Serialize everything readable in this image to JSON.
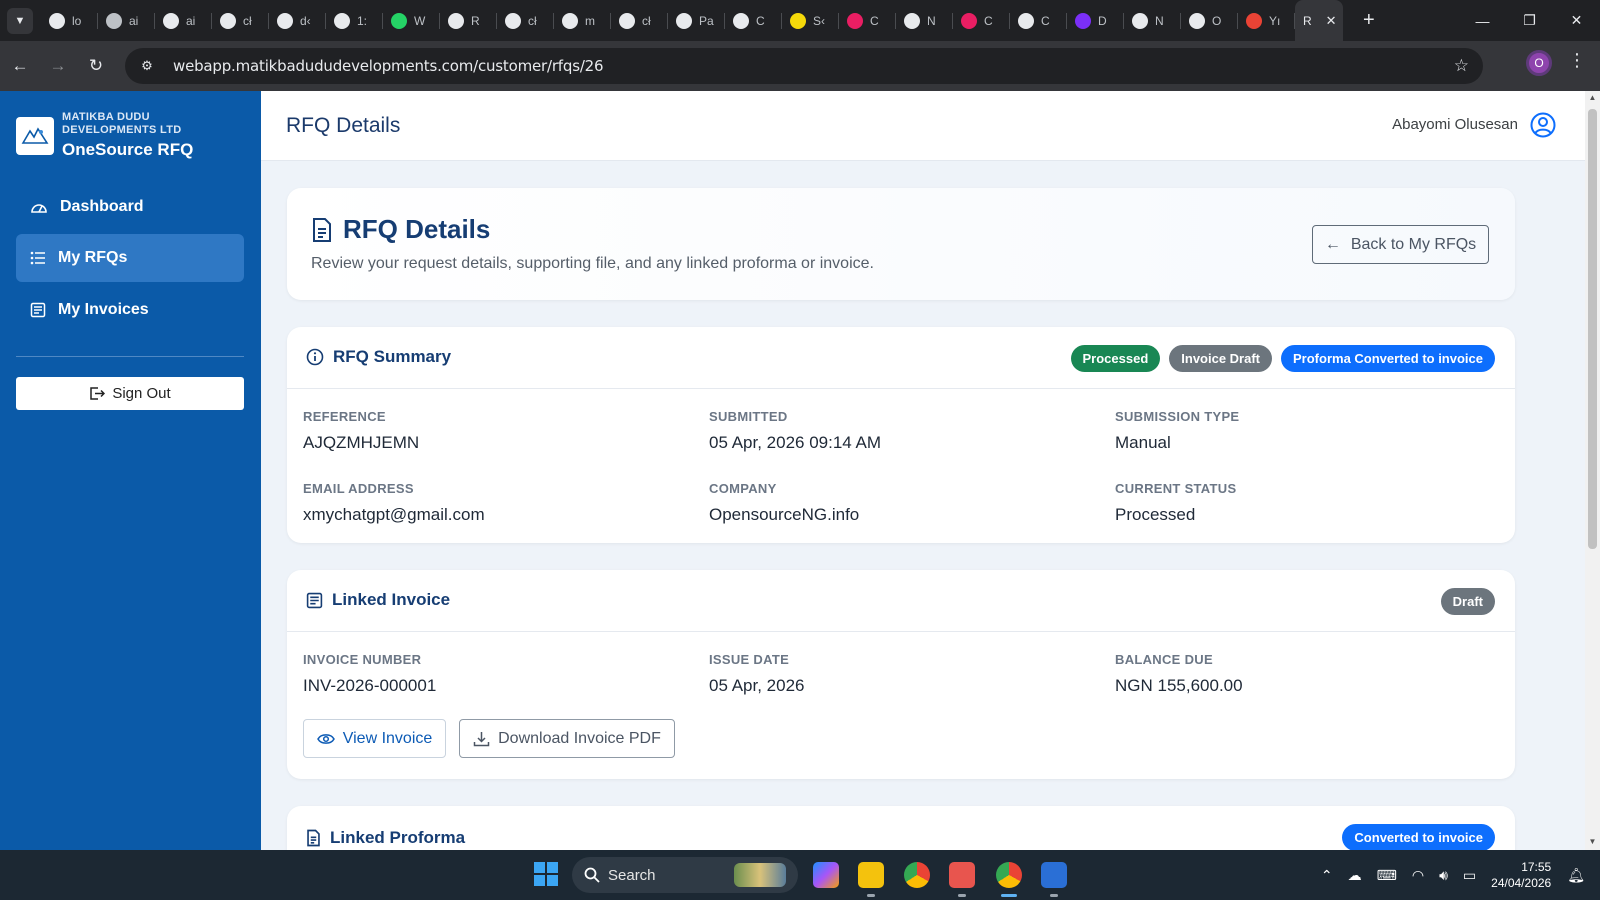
{
  "browser": {
    "tabs": [
      {
        "label": "lo",
        "icon": "mountain-icon",
        "color": "#e8eaed"
      },
      {
        "label": "ai",
        "icon": "leaf-icon",
        "color": "#bdc1c6"
      },
      {
        "label": "ai",
        "icon": "globe-icon",
        "color": "#e8eaed"
      },
      {
        "label": "cł",
        "icon": "openai-icon",
        "color": "#e8eaed"
      },
      {
        "label": "d‹",
        "icon": "facebook-icon",
        "color": "#e8eaed"
      },
      {
        "label": "1:",
        "icon": "globe-icon",
        "color": "#e8eaed"
      },
      {
        "label": "W",
        "icon": "whatsapp-icon",
        "color": "#25d366"
      },
      {
        "label": "R",
        "icon": "r-logo-icon",
        "color": "#e8eaed"
      },
      {
        "label": "cł",
        "icon": "openai-icon",
        "color": "#e8eaed"
      },
      {
        "label": "m",
        "icon": "globe-icon",
        "color": "#e8eaed"
      },
      {
        "label": "cł",
        "icon": "openai-icon",
        "color": "#e8eaed"
      },
      {
        "label": "Pa",
        "icon": "globe-icon",
        "color": "#e8eaed"
      },
      {
        "label": "C",
        "icon": "openai-icon",
        "color": "#e8eaed"
      },
      {
        "label": "S‹",
        "icon": "x-icon",
        "color": "#f5d90a"
      },
      {
        "label": "C",
        "icon": "pink-app-icon",
        "color": "#e91e63"
      },
      {
        "label": "N",
        "icon": "globe-icon",
        "color": "#e8eaed"
      },
      {
        "label": "C",
        "icon": "pink-app-icon",
        "color": "#e91e63"
      },
      {
        "label": "C",
        "icon": "openai-icon",
        "color": "#e8eaed"
      },
      {
        "label": "D",
        "icon": "purple-app-icon",
        "color": "#7b2ff7"
      },
      {
        "label": "N",
        "icon": "globe-icon",
        "color": "#e8eaed"
      },
      {
        "label": "O",
        "icon": "globe-icon",
        "color": "#e8eaed"
      },
      {
        "label": "Yı",
        "icon": "gmail-icon",
        "color": "#ea4335"
      }
    ],
    "active_tab_label": "R",
    "url": "webapp.matikbadududevelopments.com/customer/rfqs/26",
    "profile_initial": "O"
  },
  "sidebar": {
    "company": "MATIKBA DUDU DEVELOPMENTS LTD",
    "app_name": "OneSource RFQ",
    "items": [
      {
        "label": "Dashboard",
        "icon": "dashboard-icon",
        "active": false
      },
      {
        "label": "My RFQs",
        "icon": "list-icon",
        "active": true
      },
      {
        "label": "My Invoices",
        "icon": "invoice-icon",
        "active": false
      }
    ],
    "signout_label": "Sign Out"
  },
  "topbar": {
    "title": "RFQ Details",
    "user_name": "Abayomi Olusesan"
  },
  "hero": {
    "title": "RFQ Details",
    "subtitle": "Review your request details, supporting file, and any linked proforma or invoice.",
    "back_label": "Back to My RFQs"
  },
  "summary": {
    "title": "RFQ Summary",
    "badges": [
      {
        "label": "Processed",
        "color": "#198754"
      },
      {
        "label": "Invoice Draft",
        "color": "#6c757d"
      },
      {
        "label": "Proforma Converted to invoice",
        "color": "#0d6efd"
      }
    ],
    "fields": [
      {
        "label": "REFERENCE",
        "value": "AJQZMHJEMN"
      },
      {
        "label": "SUBMITTED",
        "value": "05 Apr, 2026 09:14 AM"
      },
      {
        "label": "SUBMISSION TYPE",
        "value": "Manual"
      },
      {
        "label": "EMAIL ADDRESS",
        "value": "xmychatgpt@gmail.com"
      },
      {
        "label": "COMPANY",
        "value": "OpensourceNG.info"
      },
      {
        "label": "CURRENT STATUS",
        "value": "Processed"
      }
    ]
  },
  "invoice": {
    "title": "Linked Invoice",
    "badge": {
      "label": "Draft",
      "color": "#6c757d"
    },
    "fields": [
      {
        "label": "INVOICE NUMBER",
        "value": "INV-2026-000001"
      },
      {
        "label": "ISSUE DATE",
        "value": "05 Apr, 2026"
      },
      {
        "label": "BALANCE DUE",
        "value": "NGN 155,600.00"
      }
    ],
    "view_label": "View Invoice",
    "download_label": "Download Invoice PDF"
  },
  "proforma": {
    "title": "Linked Proforma",
    "badge": {
      "label": "Converted to invoice",
      "color": "#0d6efd"
    }
  },
  "taskbar": {
    "search_label": "Search",
    "time": "17:55",
    "date": "24/04/2026"
  }
}
